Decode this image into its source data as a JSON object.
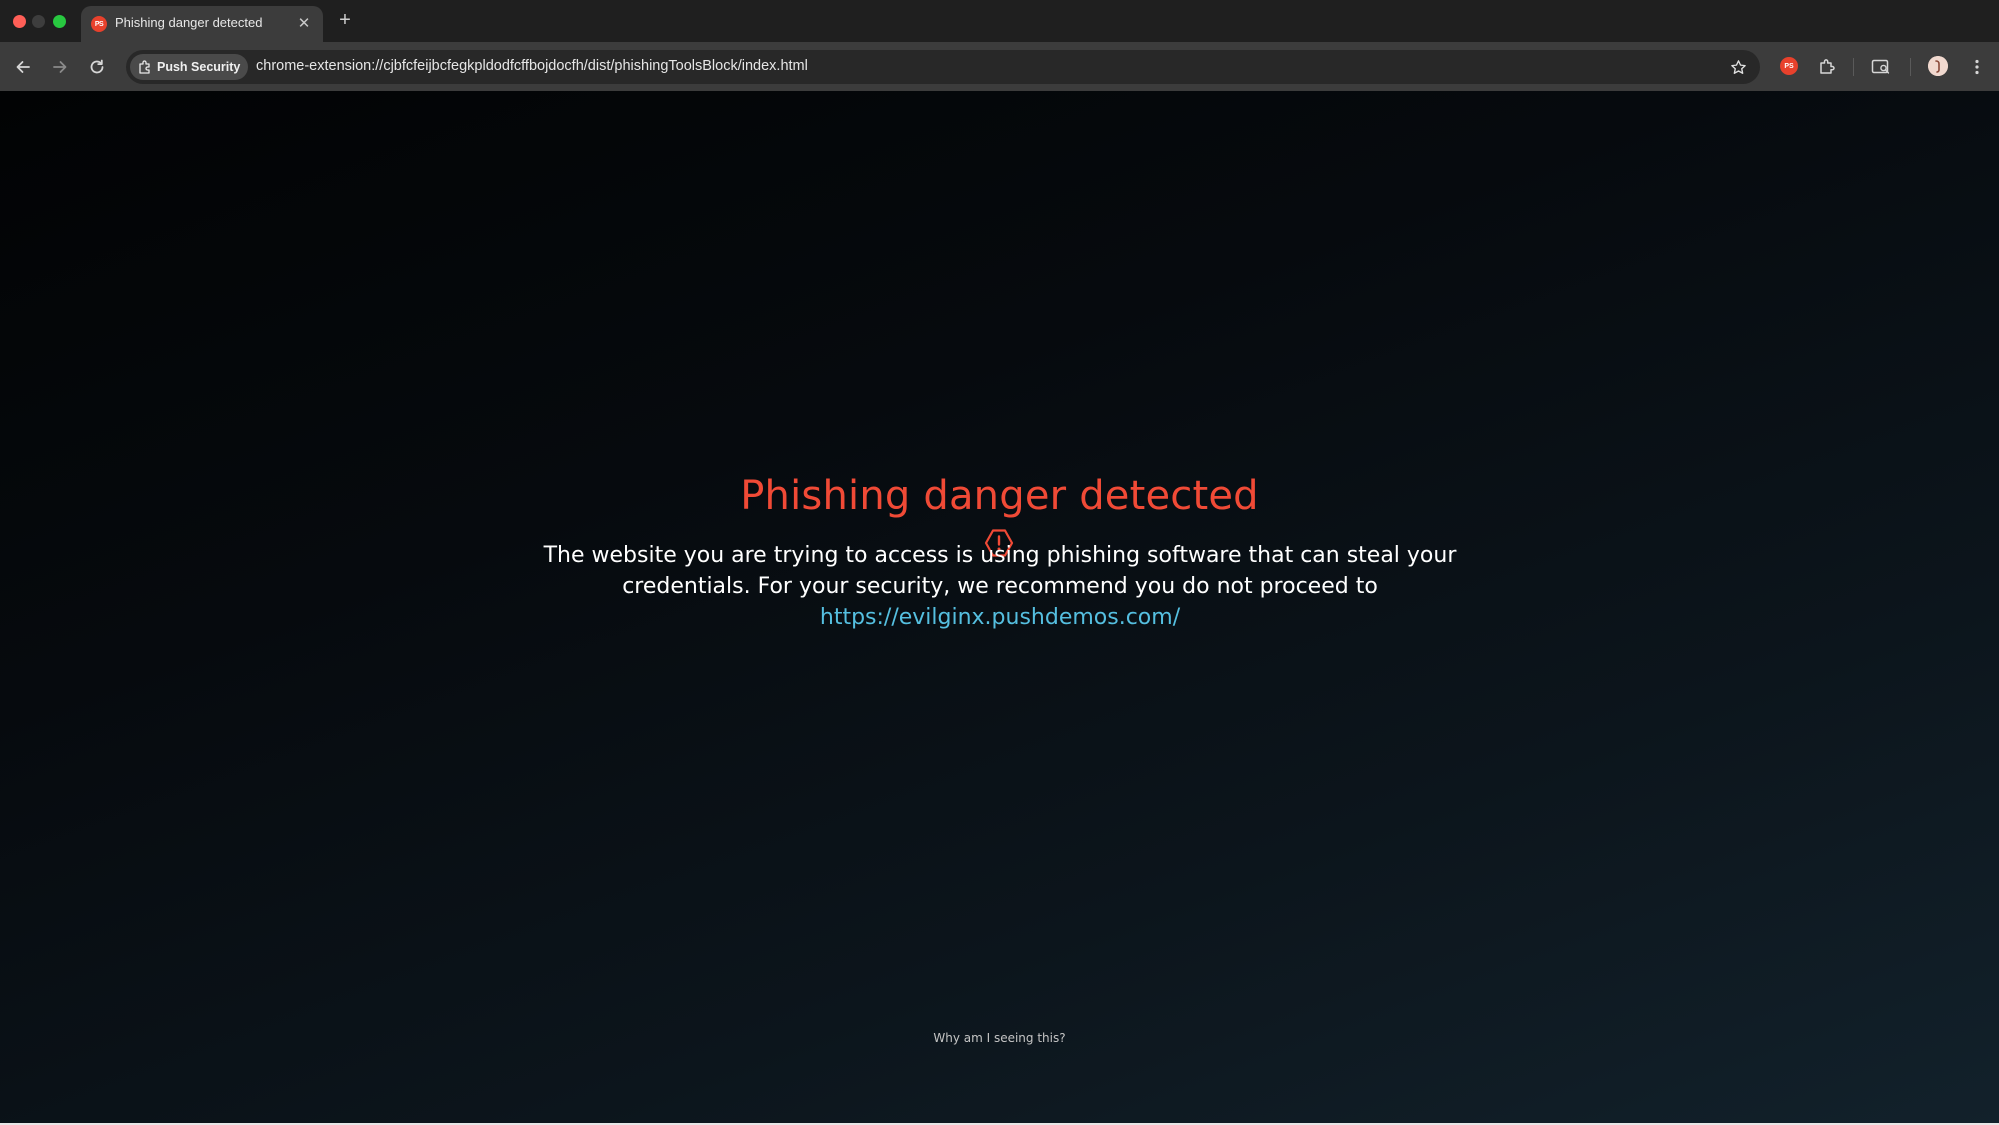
{
  "browser": {
    "tab": {
      "title": "Phishing danger detected",
      "favicon_text": "PS",
      "close_glyph": "✕"
    },
    "new_tab_glyph": "+",
    "omnibox": {
      "chip_label": "Push Security",
      "url": "chrome-extension://cjbfcfeijbcfegkpldodfcffbojdocfh/dist/phishingToolsBlock/index.html"
    },
    "extension_badge_text": "PS"
  },
  "page": {
    "heading": "Phishing danger detected",
    "message_text": "The website you are trying to access is using phishing software that can steal your credentials. For your security, we recommend you do not proceed to ",
    "message_link": "https://evilginx.pushdemos.com/",
    "why_link": "Why am I seeing this?"
  },
  "colors": {
    "accent_red": "#f04a36",
    "link_blue": "#55bfe0",
    "background": "#0c151c"
  },
  "icons": [
    "back-icon",
    "forward-icon",
    "reload-icon",
    "extension-chip-icon",
    "star-icon",
    "push-extension-icon",
    "puzzle-icon",
    "side-panel-search-icon",
    "avatar",
    "more-icon",
    "warning-hexagon-icon"
  ]
}
